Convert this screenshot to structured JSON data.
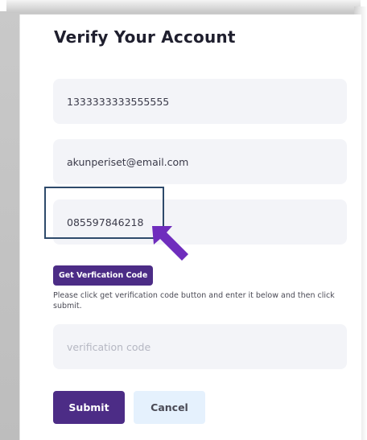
{
  "page": {
    "title": "Verify Your Account"
  },
  "form": {
    "id_number_value": "1333333333555555",
    "email_value": "akunperiset@email.com",
    "phone_value": "085597846218",
    "verification_code_placeholder": "verification code"
  },
  "actions": {
    "get_code_label": "Get Verfication Code",
    "help_text": "Please click get verification code button and enter it below and then click submit.",
    "submit_label": "Submit",
    "cancel_label": "Cancel"
  },
  "annotation": {
    "highlight_color": "#2e4a6b",
    "arrow_color": "#6f2dbd",
    "arrow_icon": "arrow-up-left-icon"
  },
  "colors": {
    "primary": "#4c2c86",
    "field_bg": "#f3f4f8",
    "cancel_bg": "#e5f1fd"
  }
}
